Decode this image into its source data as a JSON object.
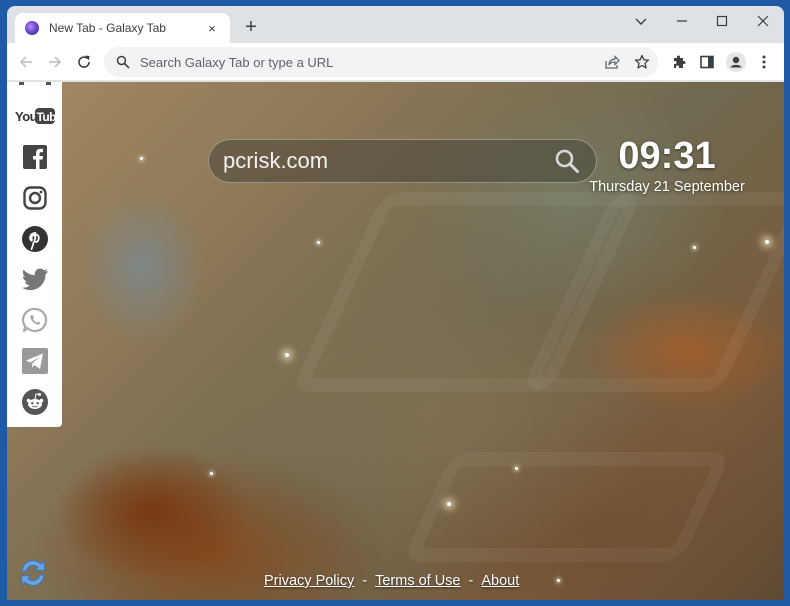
{
  "browser": {
    "tab": {
      "title": "New Tab - Galaxy Tab",
      "favicon": "galaxy-favicon",
      "close_symbol": "×"
    },
    "new_tab_symbol": "+",
    "window_controls": [
      "tab-search-chevron",
      "minimize",
      "maximize",
      "close"
    ],
    "omnibox": {
      "placeholder": "Search Galaxy Tab or type a URL",
      "value": ""
    },
    "toolbar_icons": [
      "back-arrow-icon",
      "forward-arrow-icon",
      "reload-icon",
      "share-icon",
      "star-icon",
      "extensions-puzzle-icon",
      "side-panel-icon",
      "profile-avatar-icon",
      "menu-kebab-icon"
    ]
  },
  "page": {
    "social_links": [
      {
        "name": "YouTube",
        "icon": "youtube-icon",
        "label_you": "You",
        "label_tube": "Tube"
      },
      {
        "name": "Facebook",
        "icon": "facebook-icon"
      },
      {
        "name": "Instagram",
        "icon": "instagram-icon"
      },
      {
        "name": "Pinterest",
        "icon": "pinterest-icon"
      },
      {
        "name": "Twitter",
        "icon": "twitter-icon"
      },
      {
        "name": "WhatsApp",
        "icon": "whatsapp-icon"
      },
      {
        "name": "Telegram",
        "icon": "telegram-icon"
      },
      {
        "name": "Reddit",
        "icon": "reddit-icon"
      }
    ],
    "search": {
      "value": "pcrisk.com",
      "icon": "search-icon"
    },
    "clock": {
      "time": "09:31",
      "date": "Thursday 21 September"
    },
    "footer": {
      "links": [
        "Privacy Policy",
        "Terms of Use",
        "About"
      ],
      "separator": "-"
    },
    "refresh_icon": "refresh-arrows-icon"
  },
  "colors": {
    "window_frame": "#1f5aa6",
    "tabstrip_bg": "#dee1e6",
    "omnibox_bg": "#f1f3f4",
    "icon_gray": "#5f6368",
    "social_icon_dark": "#444444",
    "social_icon_light": "#9a9a9a",
    "refresh_blue": "#6aa3e0"
  }
}
